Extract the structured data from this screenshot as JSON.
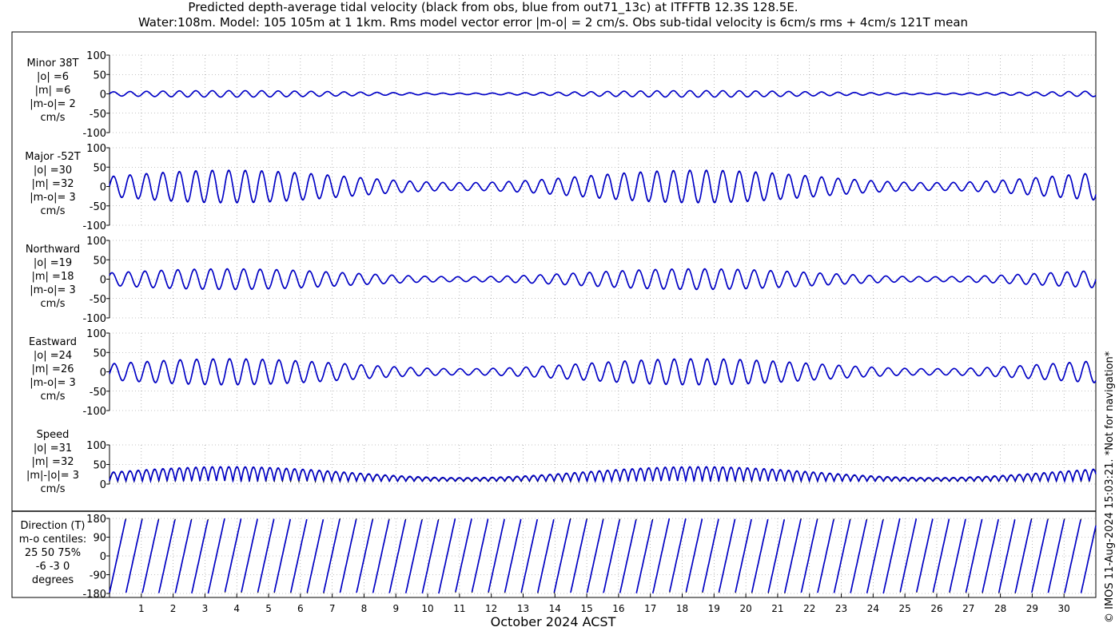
{
  "title_line1": "Predicted depth-average tidal velocity (black from obs, blue from out71_13c) at ITFFTB 12.3S 128.5E.",
  "title_line2": "Water:108m. Model: 105 105m at 1 1km. Rms model vector error |m-o| = 2 cm/s. Obs sub-tidal velocity is 6cm/s rms + 4cm/s 121T mean",
  "xlabel": "October 2024 ACST",
  "copyright": "© IMOS 11-Aug-2024 15:03:21. *Not for navigation*",
  "colors": {
    "obs": "#000000",
    "model": "#0000cc"
  },
  "chart_data": [
    {
      "type": "line",
      "name": "minor",
      "labels": [
        "Minor 38T",
        "|o| =6",
        "|m| =6",
        "|m-o|= 2",
        "cm/s"
      ],
      "ylim": [
        -100,
        100
      ],
      "yticks": [
        -100,
        -50,
        0,
        50,
        100
      ],
      "grid": true,
      "series": [
        "obs",
        "model"
      ],
      "typical_amplitude": 6
    },
    {
      "type": "line",
      "name": "major",
      "labels": [
        "Major -52T",
        "|o| =30",
        "|m| =32",
        "|m-o|= 3",
        "cm/s"
      ],
      "ylim": [
        -100,
        100
      ],
      "yticks": [
        -100,
        -50,
        0,
        50,
        100
      ],
      "grid": true,
      "series": [
        "obs",
        "model"
      ],
      "typical_amplitude": 30
    },
    {
      "type": "line",
      "name": "northward",
      "labels": [
        "Northward",
        "|o| =19",
        "|m| =18",
        "|m-o|= 3",
        "cm/s"
      ],
      "ylim": [
        -100,
        100
      ],
      "yticks": [
        -100,
        -50,
        0,
        50,
        100
      ],
      "grid": true,
      "series": [
        "obs",
        "model"
      ],
      "typical_amplitude": 19
    },
    {
      "type": "line",
      "name": "eastward",
      "labels": [
        "Eastward",
        "|o| =24",
        "|m| =26",
        "|m-o|= 3",
        "cm/s"
      ],
      "ylim": [
        -100,
        100
      ],
      "yticks": [
        -100,
        -50,
        0,
        50,
        100
      ],
      "grid": true,
      "series": [
        "obs",
        "model"
      ],
      "typical_amplitude": 24
    },
    {
      "type": "line",
      "name": "speed",
      "labels": [
        "Speed",
        "|o| =31",
        "|m| =32",
        "|m|-|o|= 3",
        "cm/s"
      ],
      "ylim": [
        0,
        100
      ],
      "yticks": [
        0,
        50,
        100
      ],
      "grid": true,
      "series": [
        "obs",
        "model"
      ],
      "typical_amplitude": 31
    },
    {
      "type": "line",
      "name": "direction",
      "labels": [
        "Direction (T)",
        "m-o centiles:",
        "25  50  75%",
        "-6 -3  0",
        "degrees"
      ],
      "ylim": [
        -180,
        180
      ],
      "yticks": [
        -180,
        -90,
        0,
        90,
        180
      ],
      "grid": true,
      "series": [
        "obs",
        "model"
      ]
    }
  ],
  "xaxis": {
    "range_days": [
      0,
      31
    ],
    "tick_labels": [
      "1",
      "2",
      "3",
      "4",
      "5",
      "6",
      "7",
      "8",
      "9",
      "10",
      "11",
      "12",
      "13",
      "14",
      "15",
      "16",
      "17",
      "18",
      "19",
      "20",
      "21",
      "22",
      "23",
      "24",
      "25",
      "26",
      "27",
      "28",
      "29",
      "30"
    ]
  }
}
